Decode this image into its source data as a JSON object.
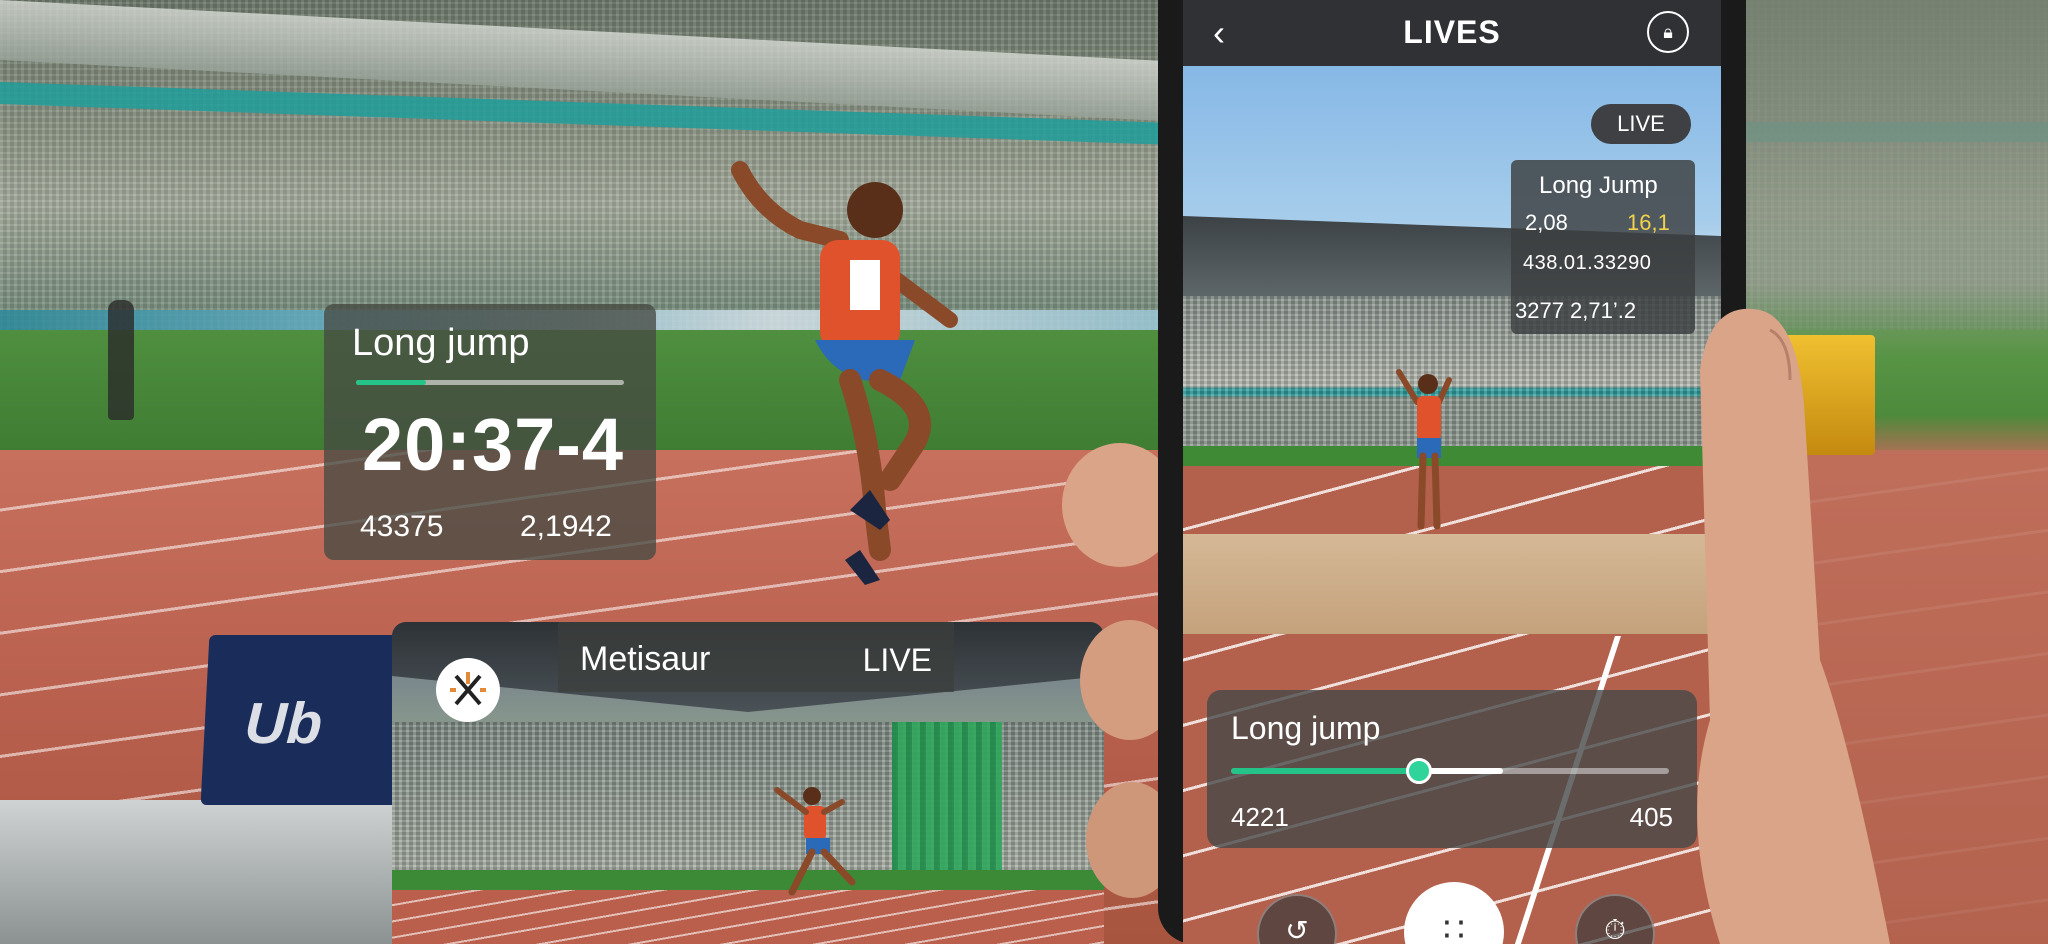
{
  "background_overlay": {
    "title": "Long jump",
    "progress": 0.26,
    "time": "20:37-4",
    "stat_left": "43375",
    "stat_right": "2,1942"
  },
  "ad_sign_text": "Ub",
  "stream_card": {
    "channel_name": "Metisaur",
    "live_label": "LIVE"
  },
  "phone": {
    "header": {
      "back_icon": "chevron-left-icon",
      "title": "LIVES",
      "lock_icon": "lock-icon"
    },
    "live_pill": "LIVE",
    "stats_panel": {
      "title": "Long Jump",
      "value_a": "2,08",
      "value_b": "16,1",
      "row2": "438.01.33290",
      "row3": "3277 2,71’.2"
    },
    "player": {
      "title": "Long jump",
      "progress": 0.43,
      "buffered": 0.62,
      "time_left": "4221",
      "time_right": "405"
    },
    "controls": [
      {
        "name": "replay-button",
        "icon": "rewind-icon",
        "glyph": "↺"
      },
      {
        "name": "menu-button",
        "icon": "grid-icon",
        "glyph": "∷"
      },
      {
        "name": "timer-button",
        "icon": "stopwatch-icon",
        "glyph": "⏱"
      }
    ]
  },
  "colors": {
    "accent": "#24c489",
    "highlight": "#f2d24a",
    "overlay": "#464a42"
  }
}
